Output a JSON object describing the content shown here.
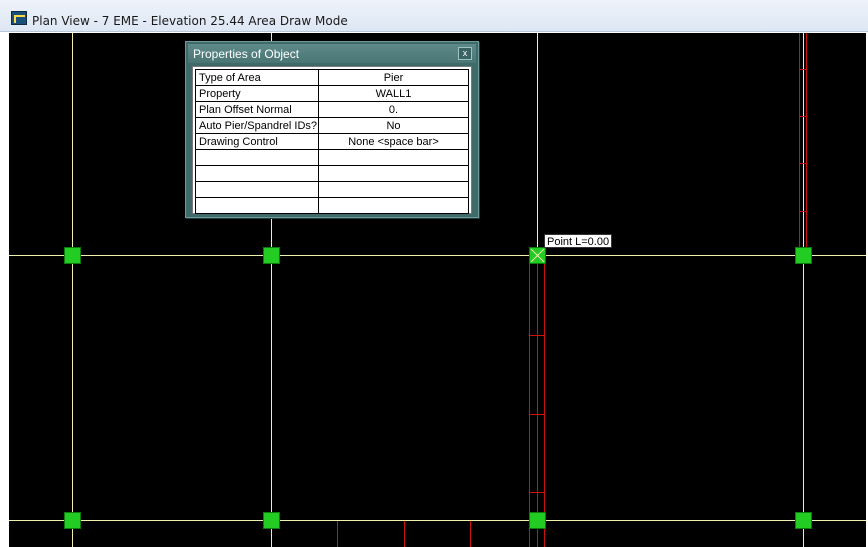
{
  "window": {
    "title": "Plan View - 7 EME - Elevation 25.44   Area Draw Mode",
    "icon": "app-icon"
  },
  "canvas": {
    "background": "#000000",
    "grid_color": "#f0f0b0",
    "wall_color": "#cc1111",
    "node_color": "#22cc22",
    "point_label": "Point  L=0.00"
  },
  "dialog": {
    "title": "Properties of Object",
    "close_label": "x",
    "rows": [
      {
        "key": "Type of Area",
        "value": "Pier"
      },
      {
        "key": "Property",
        "value": "WALL1"
      },
      {
        "key": "Plan Offset Normal",
        "value": "0."
      },
      {
        "key": "Auto Pier/Spandrel IDs?",
        "value": "No"
      },
      {
        "key": "Drawing Control",
        "value": "None  <space bar>"
      },
      {
        "key": "",
        "value": ""
      },
      {
        "key": "",
        "value": ""
      },
      {
        "key": "",
        "value": ""
      },
      {
        "key": "",
        "value": ""
      }
    ]
  }
}
